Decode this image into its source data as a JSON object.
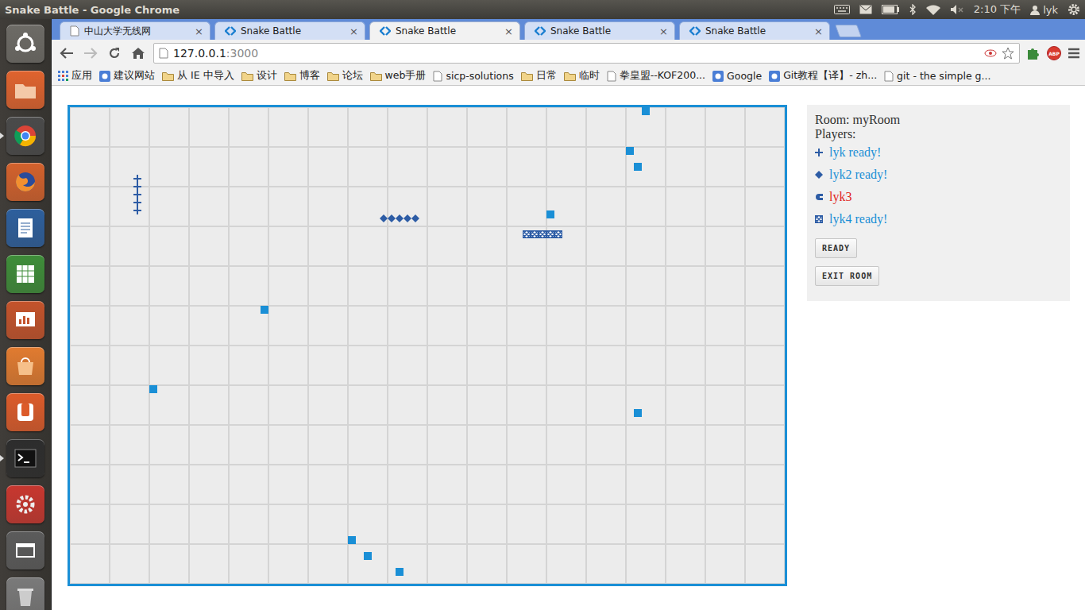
{
  "topbar": {
    "title": "Snake Battle - Google Chrome",
    "time": "2:10 下午",
    "user": "lyk",
    "muted": true
  },
  "launcher": [
    {
      "running": false
    },
    {
      "running": false
    },
    {
      "running": true
    },
    {
      "running": false
    },
    {
      "running": false
    },
    {
      "running": false
    },
    {
      "running": false
    },
    {
      "running": false
    },
    {
      "running": false
    },
    {
      "running": true
    },
    {
      "running": false
    },
    {
      "running": false
    },
    {
      "running": false
    }
  ],
  "tabs": [
    {
      "label": "中山大学无线网",
      "selected": false,
      "kind": "page",
      "close": "×"
    },
    {
      "label": "Snake Battle",
      "selected": false,
      "kind": "app",
      "close": "×"
    },
    {
      "label": "Snake Battle",
      "selected": true,
      "kind": "app",
      "close": "×"
    },
    {
      "label": "Snake Battle",
      "selected": false,
      "kind": "app",
      "close": "×"
    },
    {
      "label": "Snake Battle",
      "selected": false,
      "kind": "app",
      "close": "×"
    }
  ],
  "address": {
    "host": "127.0.0.1",
    "port": ":3000"
  },
  "extensions": {
    "abp": "ABP"
  },
  "bookmarks": [
    {
      "label": "应用",
      "kind": "apps"
    },
    {
      "label": "建议网站",
      "kind": "site"
    },
    {
      "label": "从 IE 中导入",
      "kind": "folder"
    },
    {
      "label": "设计",
      "kind": "folder"
    },
    {
      "label": "博客",
      "kind": "folder"
    },
    {
      "label": "论坛",
      "kind": "folder"
    },
    {
      "label": "web手册",
      "kind": "folder"
    },
    {
      "label": "sicp-solutions",
      "kind": "page"
    },
    {
      "label": "日常",
      "kind": "folder"
    },
    {
      "label": "临时",
      "kind": "folder"
    },
    {
      "label": "拳皇盟--KOF200...",
      "kind": "page"
    },
    {
      "label": "Google",
      "kind": "site"
    },
    {
      "label": "Git教程【译】- zh...",
      "kind": "site"
    },
    {
      "label": "git - the simple g...",
      "kind": "page"
    }
  ],
  "game": {
    "food": [
      [
        72,
        0
      ],
      [
        70,
        5
      ],
      [
        71,
        7
      ],
      [
        60,
        13
      ],
      [
        24,
        25
      ],
      [
        10,
        35
      ],
      [
        71,
        38
      ],
      [
        35,
        54
      ],
      [
        37,
        56
      ],
      [
        41,
        58
      ]
    ],
    "snakes": [
      {
        "player": "lyk",
        "kind": "cross",
        "cells": [
          [
            8,
            8
          ],
          [
            8,
            9
          ],
          [
            8,
            10
          ],
          [
            8,
            11
          ],
          [
            8,
            12
          ]
        ]
      },
      {
        "player": "lyk2",
        "kind": "diamond",
        "cells": [
          [
            39,
            13
          ],
          [
            40,
            13
          ],
          [
            41,
            13
          ],
          [
            42,
            13
          ],
          [
            43,
            13
          ]
        ]
      },
      {
        "player": "lyk4",
        "kind": "xbox",
        "cells": [
          [
            57,
            15
          ],
          [
            58,
            15
          ],
          [
            59,
            15
          ],
          [
            60,
            15
          ],
          [
            61,
            15
          ]
        ]
      }
    ]
  },
  "room": {
    "label": "Room: myRoom",
    "players_label": "Players:",
    "players": [
      {
        "label": "lyk ready!",
        "ready": true,
        "kind": "cross"
      },
      {
        "label": "lyk2 ready!",
        "ready": true,
        "kind": "diamond"
      },
      {
        "label": "lyk3",
        "ready": false,
        "kind": "half"
      },
      {
        "label": "lyk4 ready!",
        "ready": true,
        "kind": "xbox"
      }
    ],
    "buttons": [
      "READY",
      "EXIT ROOM"
    ]
  }
}
